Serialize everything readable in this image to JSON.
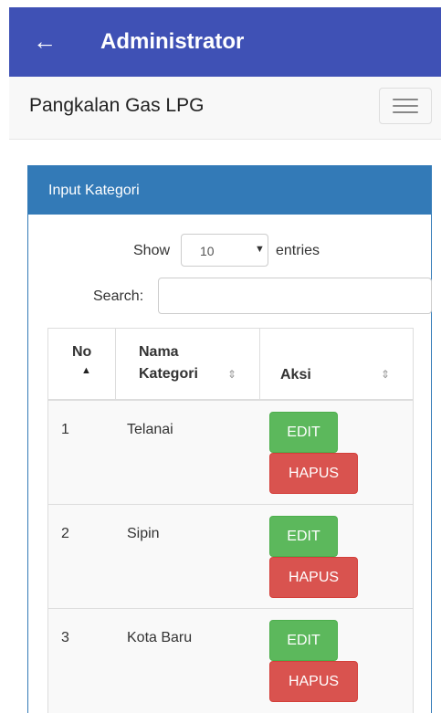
{
  "appbar": {
    "back_icon": "arrow-left-icon",
    "title": "Administrator",
    "color": "#3f51b5"
  },
  "navbar": {
    "brand": "Pangkalan Gas LPG",
    "menu_icon": "hamburger-menu-icon"
  },
  "panel": {
    "heading": "Input Kategori",
    "heading_color": "#337ab7"
  },
  "datatable": {
    "show_label": "Show",
    "length_value": "10",
    "entries_label": "entries",
    "search_label": "Search:",
    "search_value": "",
    "columns": [
      "No",
      "Nama Kategori",
      "Aksi"
    ],
    "column_lines": {
      "kategori_line1": "Nama",
      "kategori_line2": "Kategori"
    },
    "sort": {
      "active_column": "No",
      "direction": "ascending"
    },
    "rows": [
      {
        "no": "1",
        "kategori": "Telanai",
        "edit": "EDIT",
        "hapus": "HAPUS"
      },
      {
        "no": "2",
        "kategori": "Sipin",
        "edit": "EDIT",
        "hapus": "HAPUS"
      },
      {
        "no": "3",
        "kategori": "Kota Baru",
        "edit": "EDIT",
        "hapus": "HAPUS"
      }
    ]
  },
  "colors": {
    "edit": "#5cb85c",
    "hapus": "#d9534f"
  }
}
